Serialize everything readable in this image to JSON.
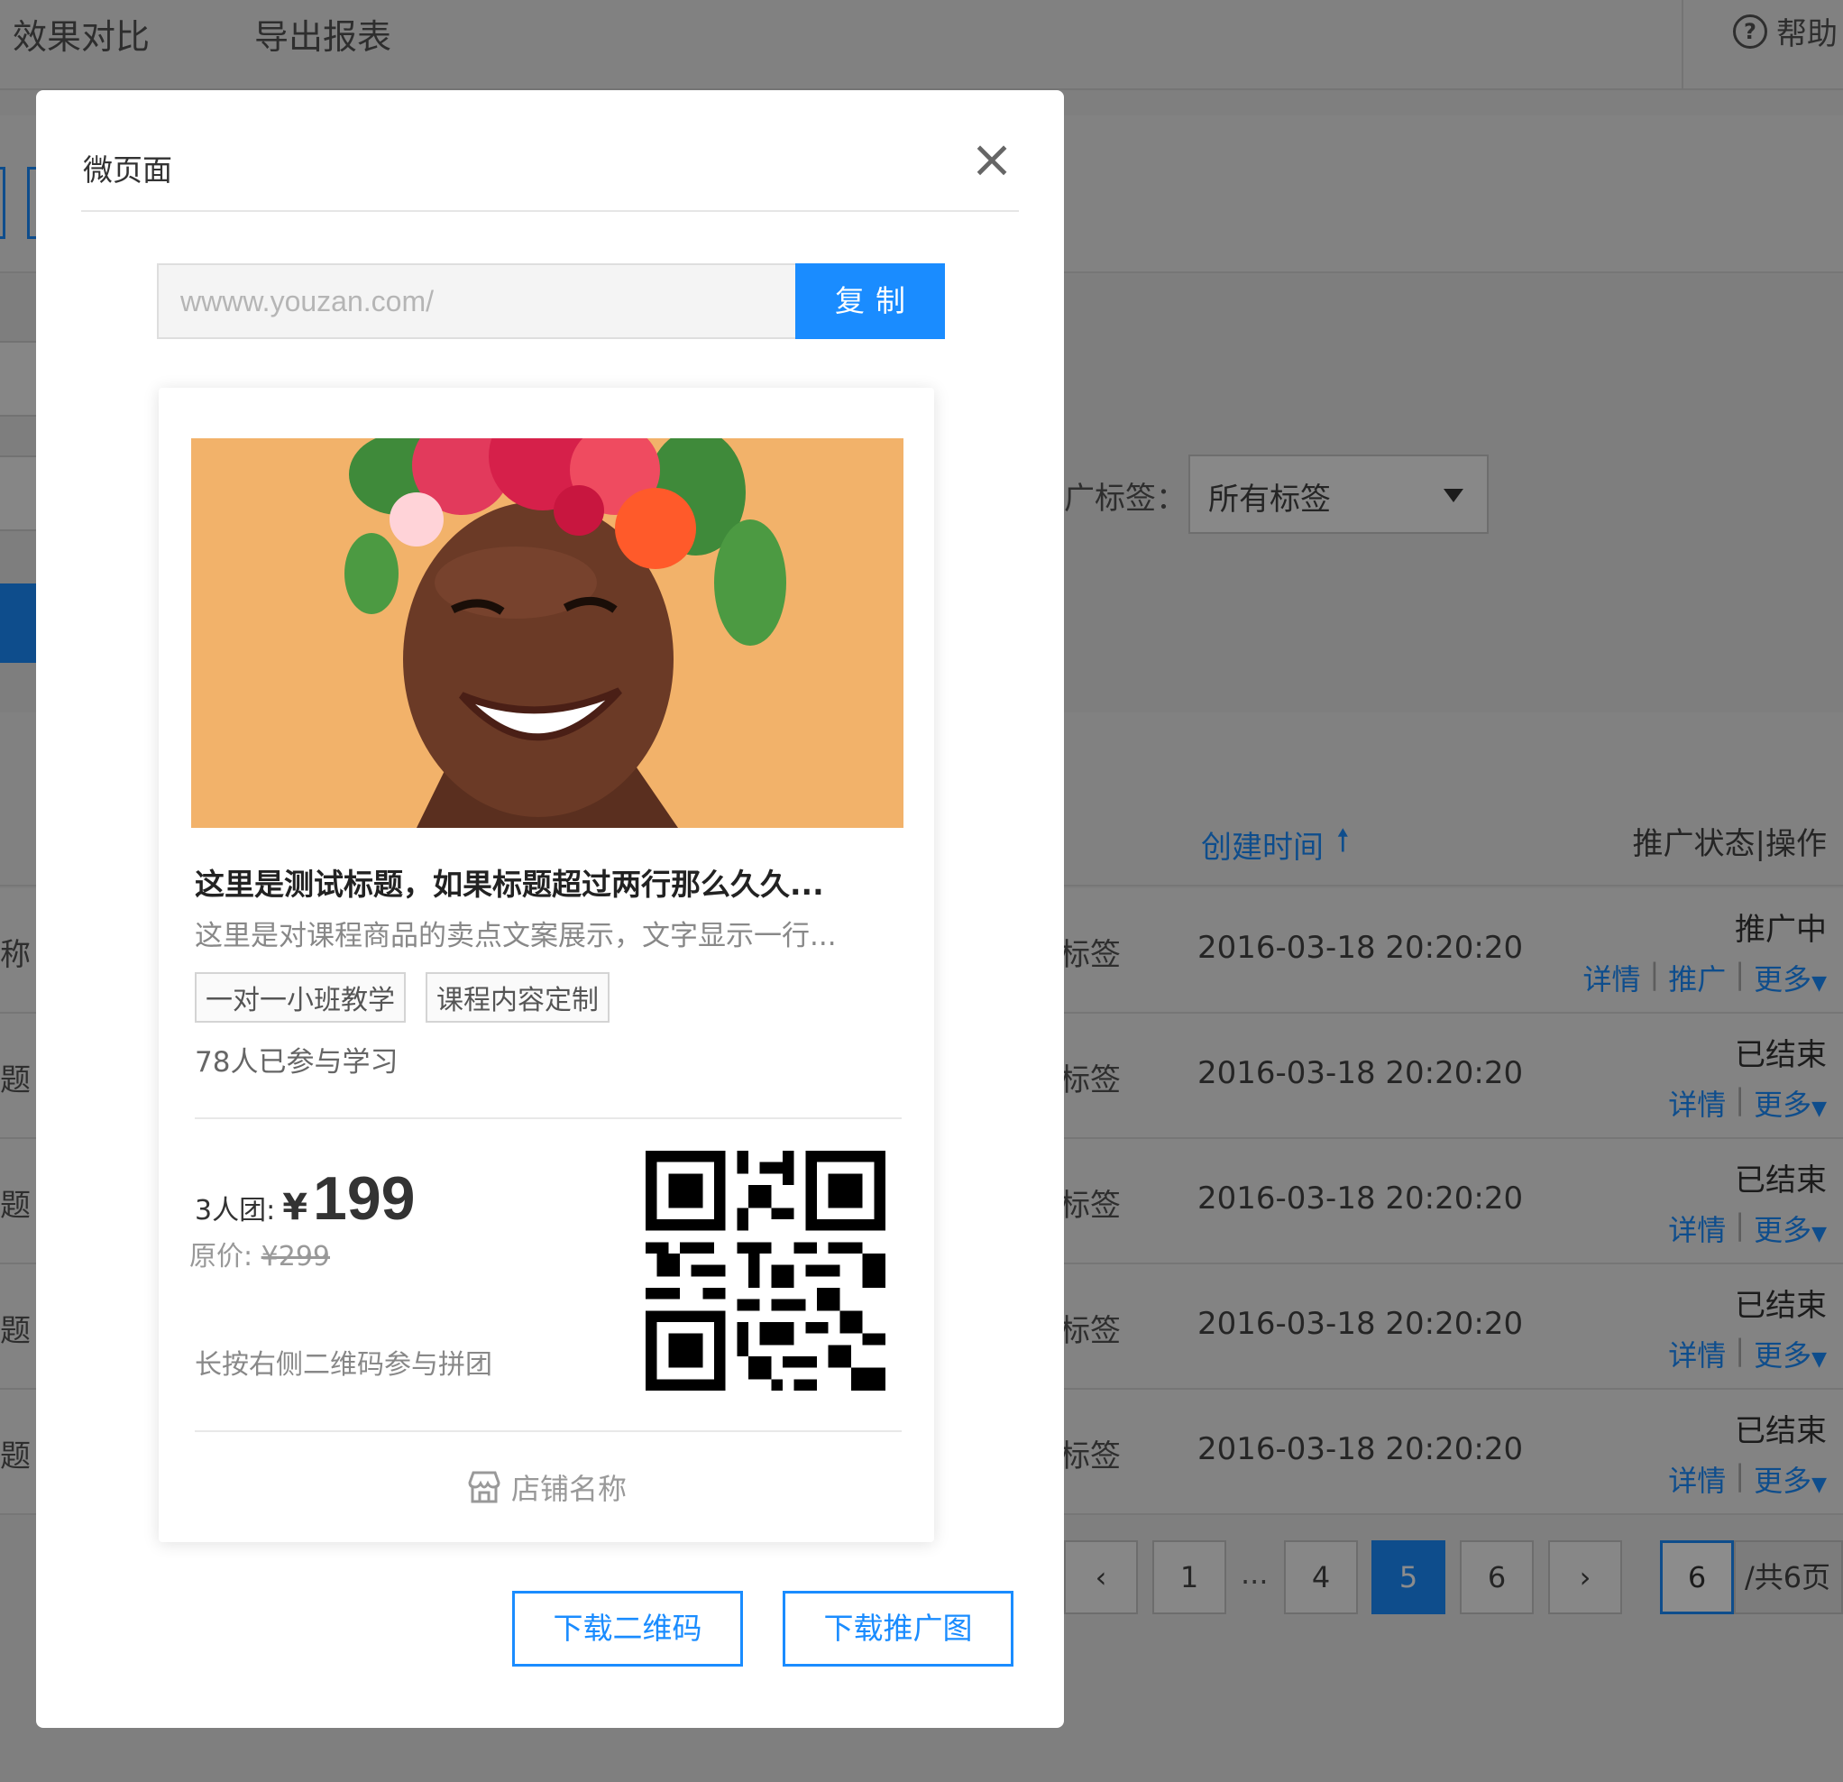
{
  "topnav": {
    "items": [
      "效果对比",
      "导出报表"
    ],
    "help_label": "帮助"
  },
  "filter": {
    "label": "广标签：",
    "select_value": "所有标签"
  },
  "table": {
    "header_time": "创建时间",
    "header_status": "推广状态|操作",
    "rows": [
      {
        "name": "称",
        "tag": "标签",
        "time": "2016-03-18 20:20:20",
        "status": "推广中",
        "actions": [
          "详情",
          "推广",
          "更多"
        ]
      },
      {
        "name": "题",
        "tag": "标签",
        "time": "2016-03-18 20:20:20",
        "status": "已结束",
        "actions": [
          "详情",
          "更多"
        ]
      },
      {
        "name": "题",
        "tag": "标签",
        "time": "2016-03-18 20:20:20",
        "status": "已结束",
        "actions": [
          "详情",
          "更多"
        ]
      },
      {
        "name": "题",
        "tag": "标签",
        "time": "2016-03-18 20:20:20",
        "status": "已结束",
        "actions": [
          "详情",
          "更多"
        ]
      },
      {
        "name": "题",
        "tag": "标签",
        "time": "2016-03-18 20:20:20",
        "status": "已结束",
        "actions": [
          "详情",
          "更多"
        ]
      }
    ]
  },
  "pagination": {
    "pages": [
      "1",
      "4",
      "5",
      "6"
    ],
    "ellipsis": "...",
    "current": "5",
    "jump_value": "6",
    "total_label": "/共6页"
  },
  "modal": {
    "title": "微页面",
    "url_value": "wwww.youzan.com/",
    "copy_label": "复制",
    "card": {
      "title": "这里是测试标题，如果标题超过两行那么久久...",
      "subtitle": "这里是对课程商品的卖点文案展示，文字显示一行...",
      "tags": [
        "一对一小班教学",
        "课程内容定制"
      ],
      "learners": "78人已参与学习",
      "group_label": "3人团:",
      "currency": "¥",
      "price": "199",
      "orig_label": "原价: ",
      "orig_price": "¥299",
      "hint": "长按右侧二维码参与拼团",
      "shop_name": "店铺名称"
    },
    "download_qr_label": "下载二维码",
    "download_poster_label": "下载推广图"
  },
  "colors": {
    "accent": "#1a8cff",
    "overlay": "rgba(0,0,0,0.45)"
  }
}
